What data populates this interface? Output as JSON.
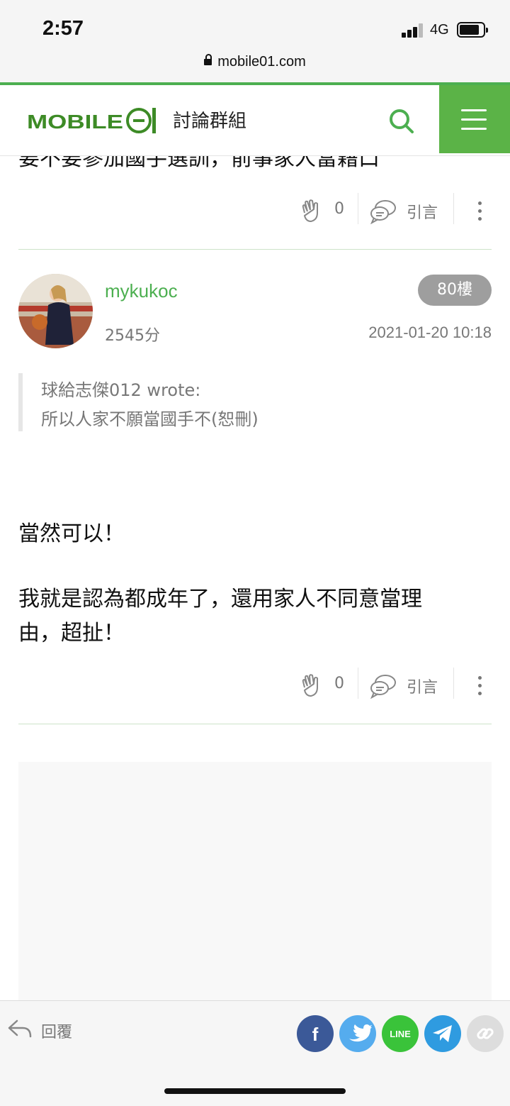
{
  "status": {
    "time": "2:57",
    "network": "4G",
    "url": "mobile01.com"
  },
  "header": {
    "logo_text": "MOBILE01",
    "section": "討論群組"
  },
  "prev_post": {
    "text_fragment": "要不要參加國手選訓，前事家人當藉口",
    "like_count": "0",
    "quote_label": "引言"
  },
  "post": {
    "username": "mykukoc",
    "score": "2545分",
    "floor": "80樓",
    "timestamp": "2021-01-20 10:18",
    "quote": {
      "author_line": "球給志傑012 wrote:",
      "text": "所以人家不願當國手不(恕刪)"
    },
    "body": [
      "當然可以！",
      "我就是認為都成年了，還用家人不同意當理",
      "由，超扯！"
    ],
    "like_count": "0",
    "quote_label": "引言"
  },
  "bottom": {
    "reply_label": "回覆",
    "share_buttons": [
      {
        "name": "facebook",
        "color": "#3b5998",
        "label": "f"
      },
      {
        "name": "twitter",
        "color": "#55acee",
        "label": ""
      },
      {
        "name": "line",
        "color": "#3ac33a",
        "label": "LINE"
      },
      {
        "name": "telegram",
        "color": "#2f9be0",
        "label": ""
      },
      {
        "name": "copy-link",
        "color": "#dddddd",
        "label": ""
      }
    ]
  },
  "colors": {
    "brand_green": "#4caf50",
    "menu_green": "#5bb347"
  }
}
